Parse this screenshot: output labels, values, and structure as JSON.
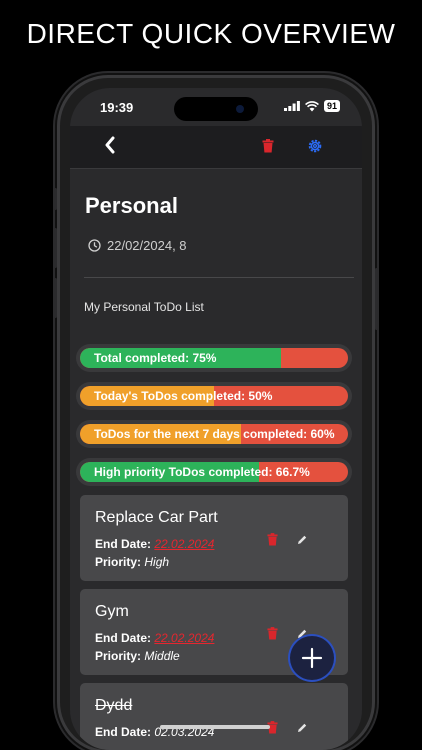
{
  "headline": "DIRECT QUICK OVERVIEW",
  "status": {
    "time": "19:39",
    "battery": "91"
  },
  "nav": {
    "back_icon": "chevron-left-icon",
    "delete_icon": "trash-icon",
    "settings_icon": "gear-icon"
  },
  "colors": {
    "accent": "#2b6cf6",
    "danger": "#d9262c",
    "green": "#2db35a",
    "orange": "#f0a02a",
    "red": "#e4513e"
  },
  "list": {
    "title": "Personal",
    "date": "22/02/2024, 8",
    "description": "My Personal ToDo List"
  },
  "progress": [
    {
      "label": "Total completed: 75%",
      "value": 0.75,
      "color": "#2db35a"
    },
    {
      "label": "Today's ToDos completed: 50%",
      "value": 0.5,
      "color": "#f0a02a"
    },
    {
      "label": "ToDos for the next 7 days completed: 60%",
      "value": 0.6,
      "color": "#f0a02a"
    },
    {
      "label": "High priority ToDos completed: 66.7%",
      "value": 0.667,
      "color": "#2db35a"
    }
  ],
  "todos": [
    {
      "name": "Replace Car Part",
      "end_label": "End Date:",
      "end_date": "22.02.2024",
      "priority_label": "Priority:",
      "priority": "High"
    },
    {
      "name": "Gym",
      "end_label": "End Date:",
      "end_date": "22.02.2024",
      "priority_label": "Priority:",
      "priority": "Middle"
    },
    {
      "name": "Dydd",
      "end_label": "End Date:",
      "end_date": "02.03.2024"
    }
  ],
  "fab_icon": "plus-icon"
}
